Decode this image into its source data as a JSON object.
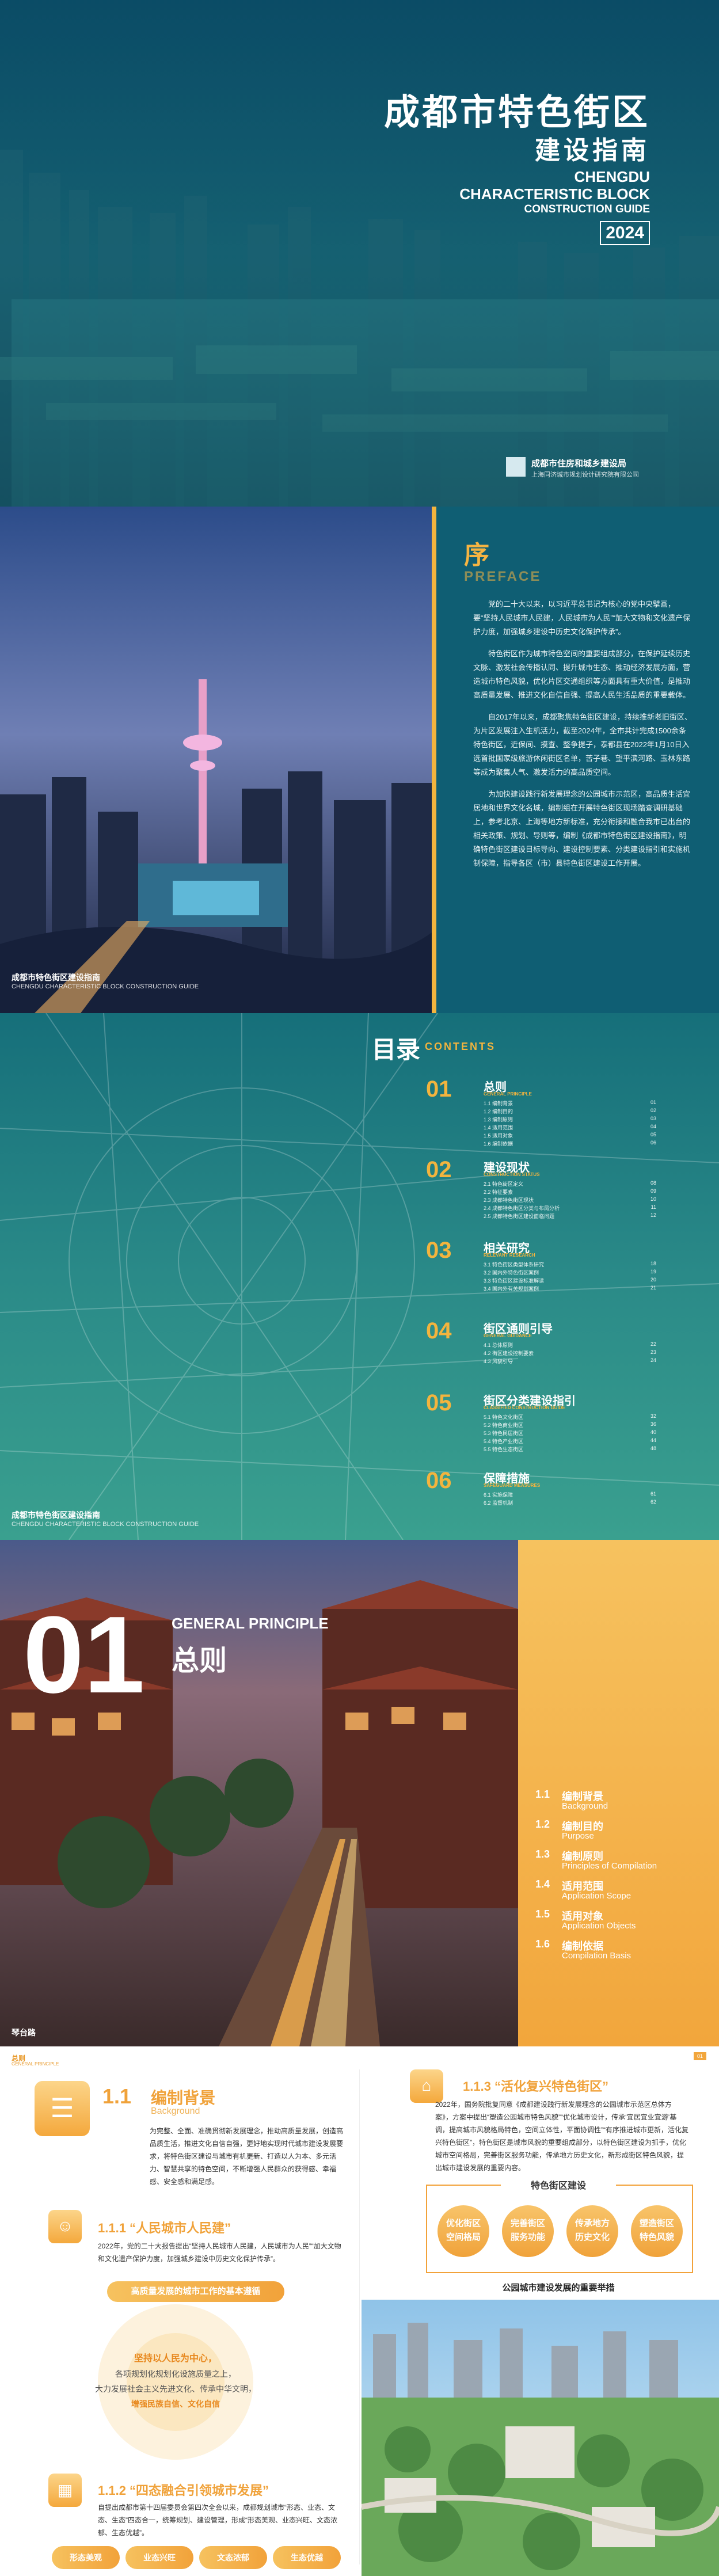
{
  "cover": {
    "title_zh": "成都市特色街区",
    "subtitle_zh": "建设指南",
    "title_en_1": "CHENGDU",
    "title_en_2": "CHARACTERISTIC BLOCK",
    "title_en_3": "CONSTRUCTION GUIDE",
    "year": "2024",
    "org_1": "成都市住房和城乡建设局",
    "org_2": "上海同济城市规划设计研究院有限公司"
  },
  "preface": {
    "heading": "序",
    "heading_en": "PREFACE",
    "paragraphs": [
      "党的二十大以来，以习近平总书记为核心的党中央擘画，要“坚持人民城市人民建，人民城市为人民”“加大文物和文化遗产保护力度，加强城乡建设中历史文化保护传承”。",
      "特色街区作为城市特色空间的重要组成部分，在保护延续历史文脉、激发社会传播认同、提升城市生态、推动经济发展方面，营造城市特色风貌，优化片区交通组织等方面具有重大价值，是推动高质量发展、推进文化自信自强、提高人民生活品质的重要载体。",
      "自2017年以来，成都聚焦特色街区建设，持续推新老旧街区、为片区发展注入生机活力，截至2024年，全市共计完成1500余条特色街区，近保间、摸查、整争提子，泰都县在2022年1月10日入选首批国家级旅游休闲街区名单，苦子巷、望平滨河路、玉林东路等成为聚集人气、激发活力的高品质空间。",
      "为加快建设践行新发展理念的公园城市示范区，高品质生活宜居地和世界文化名城，编制组在开展特色街区现场踏查调研基础上，参考北京、上海等地方新标准，充分衔接和融合我市已出台的相关政策、规划、导则等，编制《成都市特色街区建设指南》，明确特色街区建设目标导向、建设控制要素、分类建设指引和实施机制保障，指导各区（市）县特色街区建设工作开展。"
    ],
    "caption_zh": "成都市特色街区建设指南",
    "caption_en": "CHENGDU CHARACTERISTIC BLOCK CONSTRUCTION GUIDE"
  },
  "contents": {
    "heading": "目录",
    "heading_en": "CONTENTS",
    "sections": [
      {
        "num": "01",
        "title": "总则",
        "sub": "GENERAL PRINCIPLE",
        "items": [
          [
            "1.1 编制背景",
            "01"
          ],
          [
            "1.2 编制目的",
            "02"
          ],
          [
            "1.3 编制原则",
            "03"
          ],
          [
            "1.4 适用范围",
            "04"
          ],
          [
            "1.5 适用对象",
            "05"
          ],
          [
            "1.6 编制依据",
            "06"
          ]
        ]
      },
      {
        "num": "02",
        "title": "建设现状",
        "sub": "CONSTRUCTION STATUS",
        "items": [
          [
            "2.1 特色街区定义",
            "08"
          ],
          [
            "2.2 特征要素",
            "09"
          ],
          [
            "2.3 成都特色街区现状",
            "10"
          ],
          [
            "2.4 成都特色街区分类与布局分析",
            "11"
          ],
          [
            "2.5 成都特色街区建设面临问题",
            "12"
          ]
        ]
      },
      {
        "num": "03",
        "title": "相关研究",
        "sub": "RELEVANT RESEARCH",
        "items": [
          [
            "3.1 特色街区类型体系研究",
            "18"
          ],
          [
            "3.2 国内外特色街区案例",
            "19"
          ],
          [
            "3.3 特色街区建设标准解读",
            "20"
          ],
          [
            "3.4 国内外有关规划案例",
            "21"
          ]
        ]
      },
      {
        "num": "04",
        "title": "街区通则引导",
        "sub": "GENERAL GUIDANCE",
        "items": [
          [
            "4.1 总体原则",
            "22"
          ],
          [
            "4.2 街区建设控制要素",
            "23"
          ],
          [
            "4.3 风貌引导",
            "24"
          ]
        ]
      },
      {
        "num": "05",
        "title": "街区分类建设指引",
        "sub": "CLASSIFIED CONSTRUCTION GUIDE",
        "items": [
          [
            "5.1 特色文化街区",
            "32"
          ],
          [
            "5.2 特色商业街区",
            "36"
          ],
          [
            "5.3 特色民居街区",
            "40"
          ],
          [
            "5.4 特色产业街区",
            "44"
          ],
          [
            "5.5 特色生态街区",
            "48"
          ]
        ]
      },
      {
        "num": "06",
        "title": "保障措施",
        "sub": "SAFEGUARD MEASURES",
        "items": [
          [
            "6.1 实施保障",
            "61"
          ],
          [
            "6.2 监督机制",
            "62"
          ]
        ]
      }
    ],
    "caption_zh": "成都市特色街区建设指南",
    "caption_en": "CHENGDU CHARACTERISTIC BLOCK CONSTRUCTION GUIDE"
  },
  "chapter": {
    "num": "01",
    "title_en": "GENERAL PRINCIPLE",
    "title_zh": "总则",
    "caption": "琴台路",
    "items": [
      {
        "n": "1.1",
        "zh": "编制背景",
        "en": "Background"
      },
      {
        "n": "1.2",
        "zh": "编制目的",
        "en": "Purpose"
      },
      {
        "n": "1.3",
        "zh": "编制原则",
        "en": "Principles of Compilation"
      },
      {
        "n": "1.4",
        "zh": "适用范围",
        "en": "Application Scope"
      },
      {
        "n": "1.5",
        "zh": "适用对象",
        "en": "Application Objects"
      },
      {
        "n": "1.6",
        "zh": "编制依据",
        "en": "Compilation Basis"
      }
    ]
  },
  "spread": {
    "header_zh": "总则",
    "header_en": "GENERAL PRINCIPLE",
    "page": "01",
    "sec_num": "1.1",
    "sec_zh": "编制背景",
    "sec_en": "Background",
    "intro": "为完整、全面、准确贯彻新发展理念，推动高质量发展，创造高品质生活，推进文化自信自强，更好地实现时代城市建设发展要求，将特色街区建设与城市有机更新、打造以人为本、多元活力、智慧共享的特色空间，不断增强人民群众的获得感、幸福感、安全感和满足感。",
    "s1_title": "1.1.1 “人民城市人民建”",
    "s1_text": "2022年，党的二十大报告提出“坚持人民城市人民建，人民城市为人民”“加大文物和文化遗产保护力度，加强城乡建设中历史文化保护传承”。",
    "s1_pill": "高质量发展的城市工作的基本遵循",
    "circle_l1": "坚持以人民为中心，",
    "circle_l2": "各项规划化规划化设施质量之上，",
    "circle_l3": "大力发展社会主义先进文化、传承中华文明，",
    "circle_l4": "增强民族自信、文化自信",
    "s2_title": "1.1.2 “四态融合引领城市发展”",
    "s2_text": "自提出成都市第十四届委员会第四次全会以来，成都规划城市“形态、业态、文态、生态”四态合一，统筹规划、建设管理，形成“形态美观、业态兴旺、文态浓郁、生态优越”。",
    "s2_pills": [
      "形态美观",
      "业态兴旺",
      "文态浓郁",
      "生态优越"
    ],
    "r_title": "1.1.3 “活化复兴特色街区”",
    "r_text": "2022年，国务院批复同意《成都建设践行新发展理念的公园城市示范区总体方案》，方案中提出“塑造公园城市特色风貌”“优化城市设计，传承‘宜居宜业宜游’基调，提高城市风貌格局特色，空间立体性，平面协调性”“有序推进城市更新，活化复兴特色街区”，特色街区是城市风貌的重要组成部分，以特色街区建设为抓手，优化城市空间格局，完善街区服务功能，传承地方历史文化，新形成街区特色风貌，提出城市建设发展的重要内容。",
    "r_box_title": "特色街区建设",
    "r_bubbles": [
      "优化街区\n空间格局",
      "完善街区\n服务功能",
      "传承地方\n历史文化",
      "塑造街区\n特色风貌"
    ],
    "r_caption": "公园城市建设发展的重要举措"
  }
}
